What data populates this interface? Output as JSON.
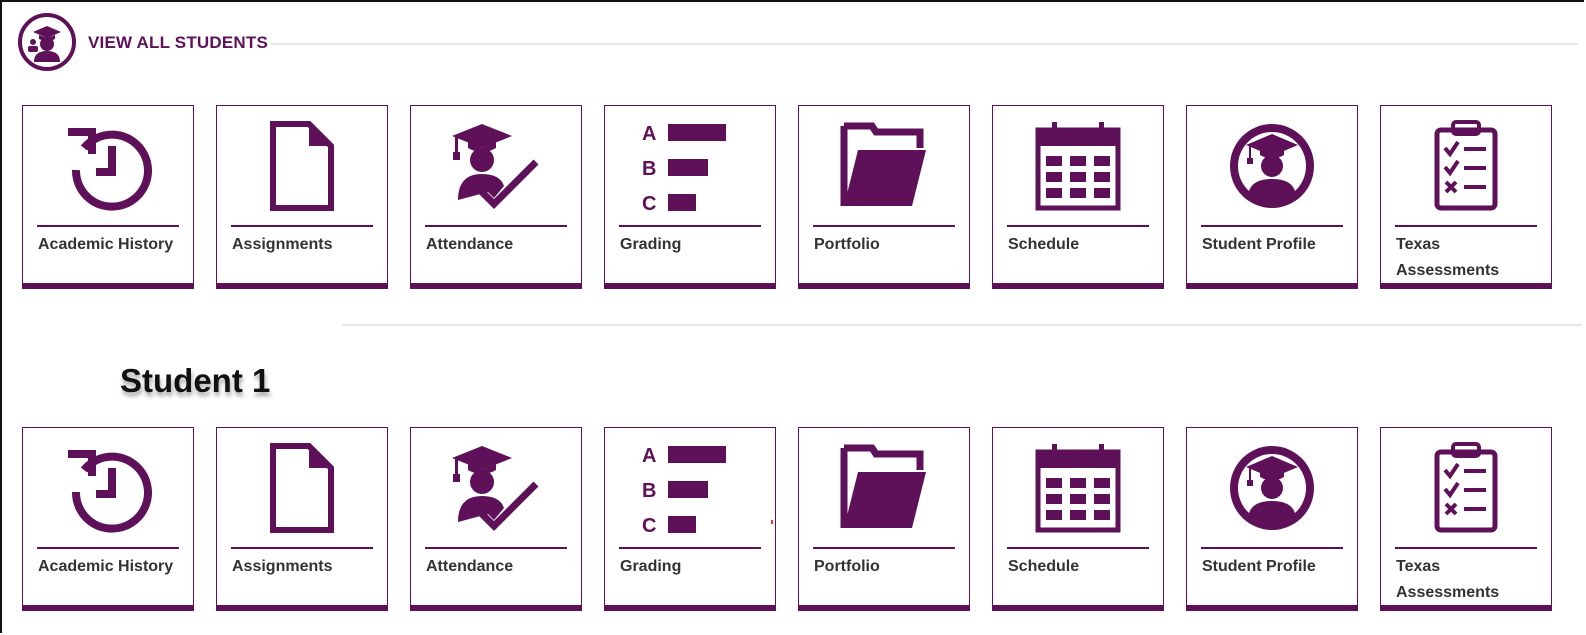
{
  "header": {
    "title": "VIEW ALL STUDENTS",
    "icon": "student-graduate-icon"
  },
  "section": {
    "title": "Student 1"
  },
  "colors": {
    "brand": "#5e1058",
    "rule": "#e6e6e6",
    "label": "#333333"
  },
  "tiles": [
    {
      "label": "Academic History",
      "icon": "history-icon"
    },
    {
      "label": "Assignments",
      "icon": "document-icon"
    },
    {
      "label": "Attendance",
      "icon": "student-check-icon"
    },
    {
      "label": "Grading",
      "icon": "grade-bars-icon",
      "grade_letters": [
        "A",
        "B",
        "C"
      ]
    },
    {
      "label": "Portfolio",
      "icon": "folder-icon"
    },
    {
      "label": "Schedule",
      "icon": "calendar-icon"
    },
    {
      "label": "Student Profile",
      "icon": "student-profile-icon"
    },
    {
      "label": "Texas Assessments",
      "icon": "clipboard-checklist-icon"
    }
  ]
}
